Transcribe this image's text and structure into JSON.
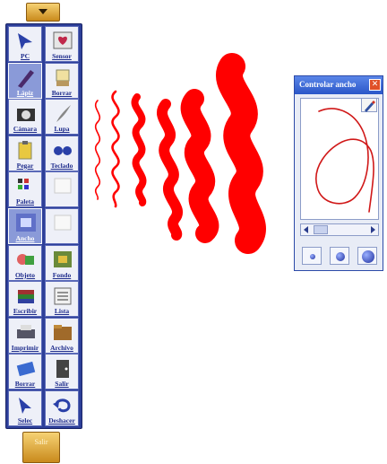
{
  "toolbar": {
    "top_handle_icon": "chevron-down-icon",
    "bottom_handle_label": "Salir",
    "tools": [
      {
        "label": "PC",
        "icon": "pointer-hand-icon",
        "active": false
      },
      {
        "label": "Sensor",
        "icon": "heart-board-icon",
        "active": false
      },
      {
        "label": "Lápiz",
        "icon": "pen-icon",
        "active": true
      },
      {
        "label": "Borrar",
        "icon": "eraser-icon",
        "active": false
      },
      {
        "label": "Cámara",
        "icon": "camera-icon",
        "active": false
      },
      {
        "label": "Lupa",
        "icon": "quill-icon",
        "active": false
      },
      {
        "label": "Pegar",
        "icon": "paste-icon",
        "active": false
      },
      {
        "label": "Teclado",
        "icon": "keys-icon",
        "active": false
      },
      {
        "label": "Paleta",
        "icon": "palette-icon",
        "active": false
      },
      {
        "label": "",
        "icon": "blank-icon",
        "active": false
      },
      {
        "label": "Ancho",
        "icon": "width-icon",
        "active": true
      },
      {
        "label": "",
        "icon": "blank-icon",
        "active": false
      },
      {
        "label": "Objeto",
        "icon": "shapes-icon",
        "active": false
      },
      {
        "label": "Fondo",
        "icon": "background-icon",
        "active": false
      },
      {
        "label": "Escribir",
        "icon": "books-icon",
        "active": false
      },
      {
        "label": "Lista",
        "icon": "list-icon",
        "active": false
      },
      {
        "label": "Imprimir",
        "icon": "printer-icon",
        "active": false
      },
      {
        "label": "Archivo",
        "icon": "folder-icon",
        "active": false
      },
      {
        "label": "Borrar",
        "icon": "clear-icon",
        "active": false
      },
      {
        "label": "Salir",
        "icon": "exit-icon",
        "active": false
      },
      {
        "label": "Selec",
        "icon": "select-arrow-icon",
        "active": false
      },
      {
        "label": "Deshacer",
        "icon": "undo-icon",
        "active": false
      }
    ]
  },
  "canvas": {
    "stroke_color": "#ff0000",
    "strokes": [
      "thin-1",
      "thin-2",
      "medium-1",
      "medium-2",
      "thick-1",
      "thick-2"
    ]
  },
  "dialog": {
    "title": "Controlar ancho",
    "close_icon": "close-icon",
    "pen_icon": "pen-icon",
    "preview_stroke_color": "#d01818",
    "scroll_left_icon": "arrow-left-icon",
    "scroll_right_icon": "arrow-right-icon",
    "size_buttons": [
      "small-dot-icon",
      "medium-dot-icon",
      "large-dot-icon"
    ]
  }
}
